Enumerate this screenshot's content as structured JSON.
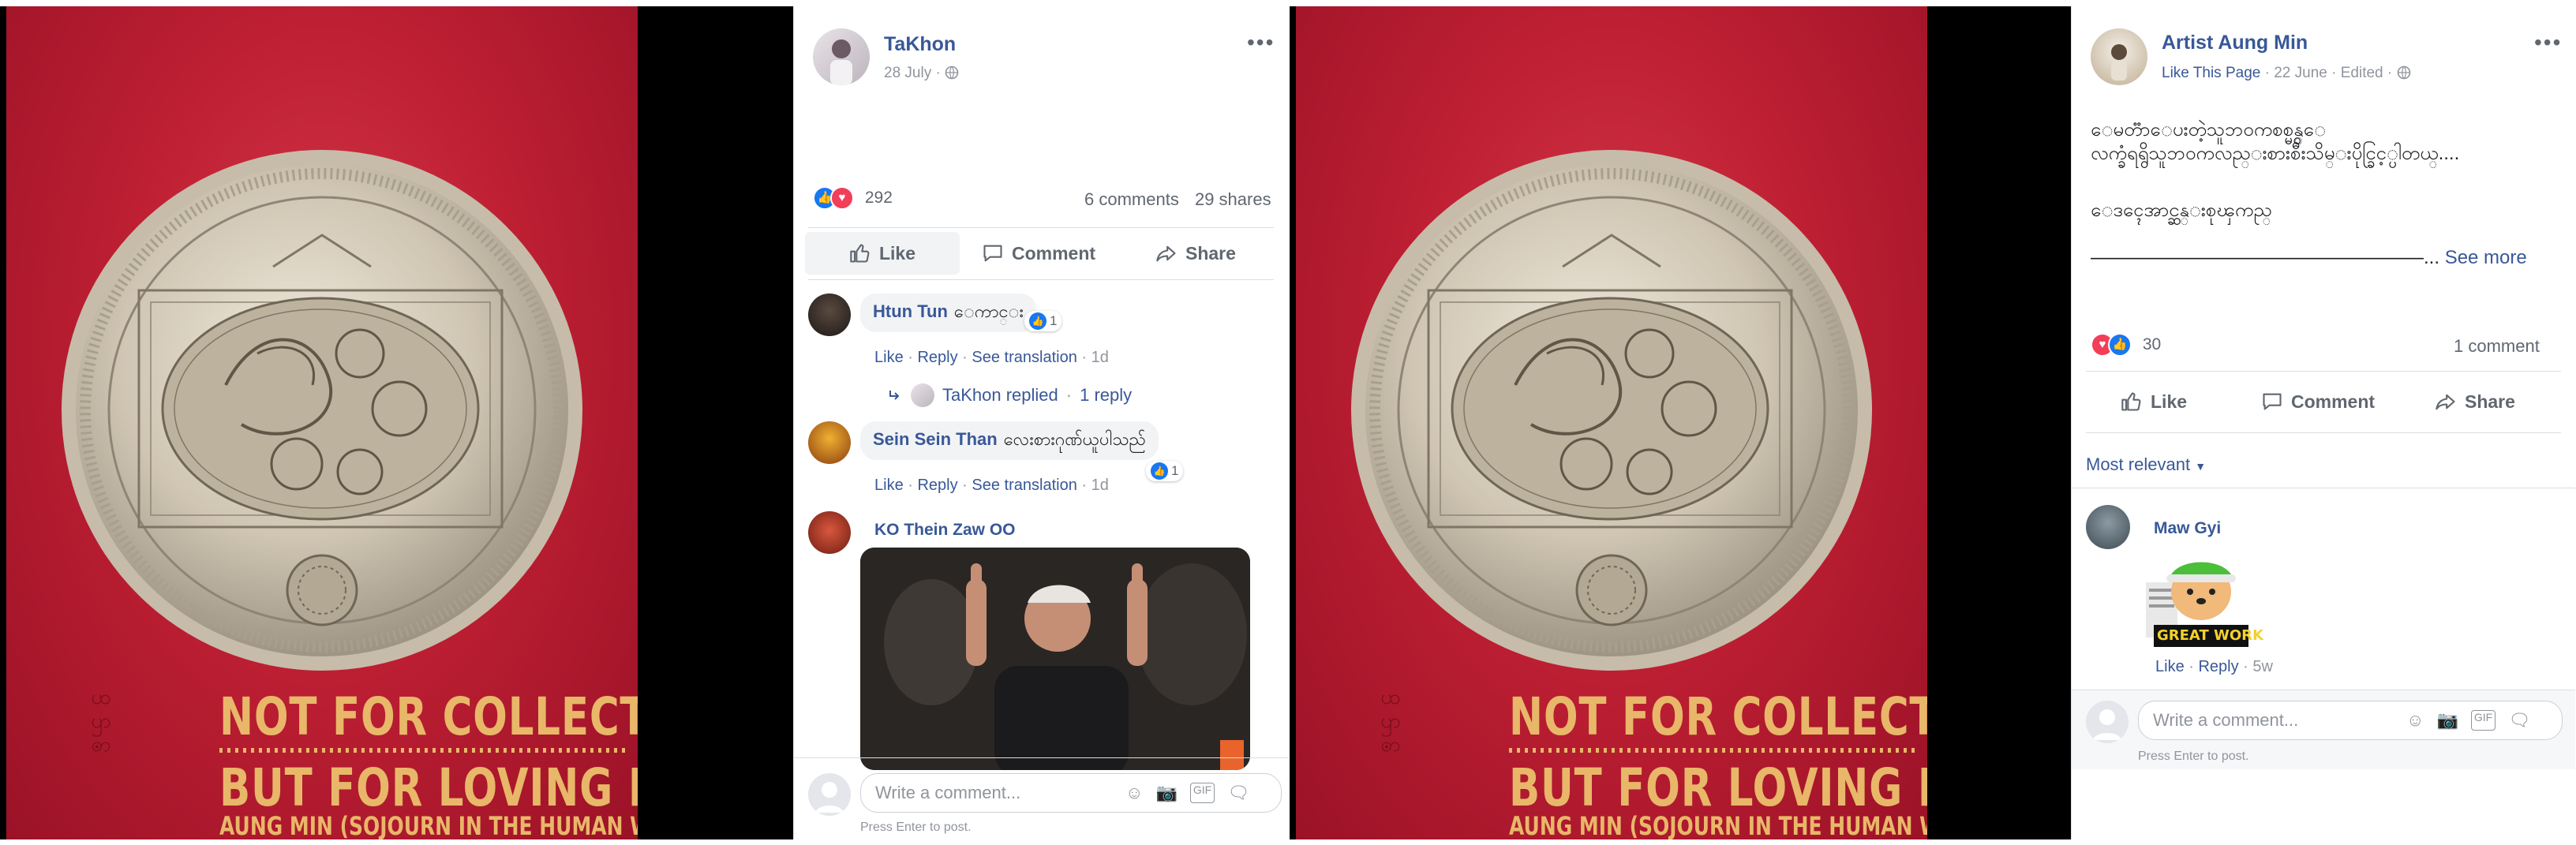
{
  "left": {
    "post": {
      "author": "TaKhon",
      "date": "28 July",
      "reaction_count": "292",
      "comments": "6 comments",
      "shares": "29 shares",
      "actions": {
        "like": "Like",
        "comment": "Comment",
        "share": "Share"
      },
      "comments_list": [
        {
          "name": "Htun Tun",
          "text": "ေကာင္း",
          "likes": "1",
          "actions": [
            "Like",
            "Reply",
            "See translation"
          ],
          "time": "1d",
          "reply_summary": {
            "author": "TaKhon",
            "label": "TaKhon replied",
            "count": "1 reply"
          }
        },
        {
          "name": "Sein Sein Than",
          "text": "လေးစားဂုဏ်ယူပါသည်",
          "likes": "1",
          "actions": [
            "Like",
            "Reply",
            "See translation"
          ],
          "time": "1d"
        },
        {
          "name": "KO Thein Zaw OO"
        }
      ],
      "composer": {
        "placeholder": "Write a comment...",
        "hint": "Press Enter to post."
      }
    },
    "poster": {
      "line1": "NOT FOR COLLECTORS",
      "line2": "BUT FOR LOVING PEOPLE",
      "line3": "AUNG MIN (SOJOURN IN THE HUMAN WORLD)"
    }
  },
  "right": {
    "post": {
      "author": "Artist Aung Min",
      "like_page": "Like This Page",
      "date": "22 June",
      "edited": "Edited",
      "body": [
        "ေမတၱာေပးတဲ့သူဘ၀ကစစ္မွန္ေ",
        "လက္ခံရရွိသူဘ၀ကလည္းစားစီးသိမ္းပိုင္ခြင့္ပါတယ္....",
        "ေဒၚေအာင္ဆန္းစုၾကည္"
      ],
      "rule": "————————————————————————————",
      "see_more_prefix": "...",
      "see_more": "See more",
      "reaction_count": "30",
      "comments": "1 comment",
      "actions": {
        "like": "Like",
        "comment": "Comment",
        "share": "Share"
      },
      "sort_label": "Most relevant",
      "comment": {
        "name": "Maw Gyi",
        "sticker_text": "GREAT WORK",
        "actions": [
          "Like",
          "Reply"
        ],
        "time": "5w"
      },
      "composer": {
        "placeholder": "Write a comment...",
        "hint": "Press Enter to post."
      }
    },
    "poster": {
      "line1": "NOT FOR COLLECTORS",
      "line2": "BUT FOR LOVING PEOPLE",
      "line3": "AUNG MIN (SOJOURN IN THE HUMAN WORLD)"
    }
  },
  "colors": {
    "link": "#385898",
    "poster_red": "#be1f33",
    "poster_gold": "#e8b769",
    "like_blue": "#1877f2",
    "love_red": "#f33e58"
  },
  "icons": [
    "more-icon",
    "globe-icon",
    "like-icon",
    "comment-icon",
    "share-icon",
    "reply-arrow-icon",
    "emoji-icon",
    "camera-icon",
    "gif-icon",
    "sticker-icon",
    "caret-down-icon"
  ]
}
